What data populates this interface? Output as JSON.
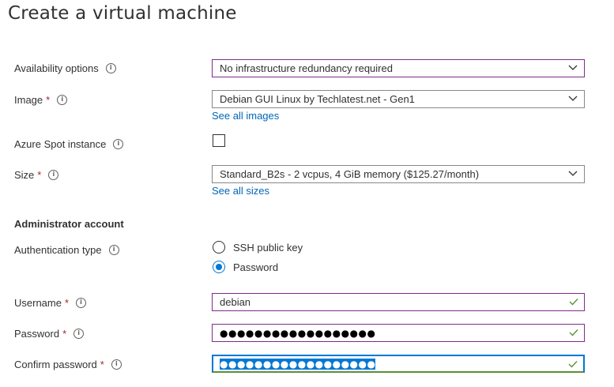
{
  "page": {
    "title": "Create a virtual machine"
  },
  "fields": {
    "availability": {
      "label": "Availability options",
      "value": "No infrastructure redundancy required"
    },
    "image": {
      "label": "Image",
      "required": "*",
      "value": "Debian GUI Linux by Techlatest.net - Gen1",
      "link": "See all images"
    },
    "spot": {
      "label": "Azure Spot instance",
      "checked": false
    },
    "size": {
      "label": "Size",
      "required": "*",
      "value": "Standard_B2s - 2 vcpus, 4 GiB memory ($125.27/month)",
      "link": "See all sizes"
    }
  },
  "admin": {
    "heading": "Administrator account",
    "auth": {
      "label": "Authentication type",
      "options": [
        "SSH public key",
        "Password"
      ],
      "selected": "Password"
    },
    "username": {
      "label": "Username",
      "required": "*",
      "value": "debian"
    },
    "password": {
      "label": "Password",
      "required": "*",
      "value": "●●●●●●●●●●●●●●●●●●"
    },
    "confirm": {
      "label": "Confirm password",
      "required": "*",
      "value": "●●●●●●●●●●●●●●●●●●"
    }
  },
  "icons": {
    "info": "info-icon",
    "chevron": "chevron-down-icon",
    "valid": "checkmark-icon"
  },
  "colors": {
    "accent": "#0078d4",
    "required": "#a4262c",
    "focus_border": "#7f2b8c",
    "valid": "#5b8f3a"
  }
}
